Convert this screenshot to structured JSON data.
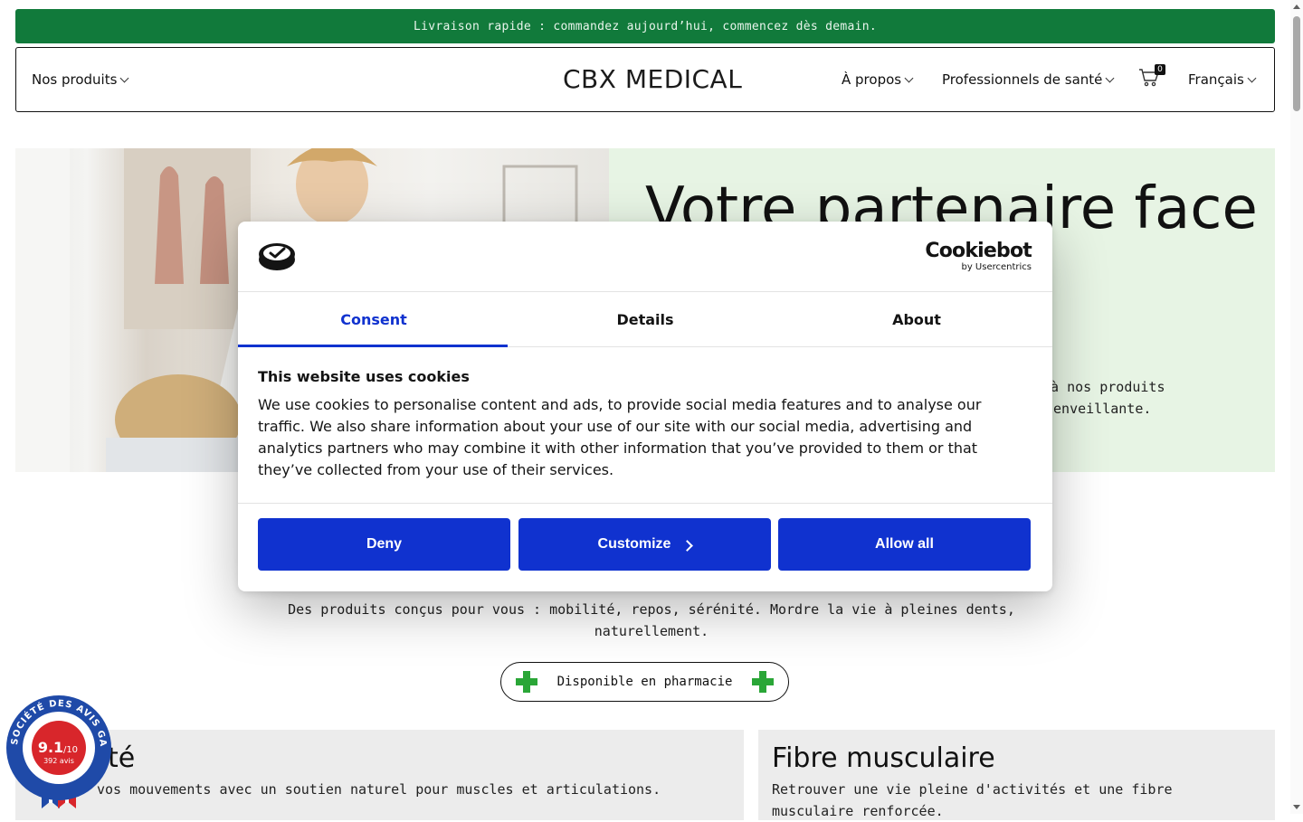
{
  "announcement": {
    "text": "Livraison rapide : commandez aujourd’hui, commencez dès demain."
  },
  "header": {
    "nav_products": "Nos produits",
    "logo": "CBX MEDICAL",
    "nav_about": "À propos",
    "nav_professionals": "Professionnels de santé",
    "cart_count": "0",
    "language": "Français"
  },
  "hero": {
    "title": "Votre partenaire face",
    "text_line1": "e à nos produits",
    "text_line2": "ienveillante."
  },
  "section": {
    "tagline": "Des produits conçus pour vous : mobilité, repos, sérénité. Mordre la vie à pleines dents, naturellement.",
    "pharmacy_button": "Disponible en pharmacie"
  },
  "cards": [
    {
      "title": "té",
      "text": "vos mouvements avec un soutien naturel pour muscles et articulations."
    },
    {
      "title": "Fibre musculaire",
      "text": "Retrouver une vie pleine d'activités et une fibre musculaire renforcée."
    }
  ],
  "review_badge": {
    "ring_text": "SOCIÉTÉ DES AVIS GARANTIS",
    "score": "9.1",
    "scale": "/10",
    "count": "392 avis"
  },
  "cookie_dialog": {
    "brand": "Cookiebot",
    "brand_sub": "by Usercentrics",
    "tabs": [
      "Consent",
      "Details",
      "About"
    ],
    "heading": "This website uses cookies",
    "body": "We use cookies to personalise content and ads, to provide social media features and to analyse our traffic. We also share information about your use of our site with our social media, advertising and analytics partners who may combine it with other information that you’ve provided to them or that they’ve collected from your use of their services.",
    "buttons": {
      "deny": "Deny",
      "customize": "Customize",
      "allow_all": "Allow all"
    }
  },
  "colors": {
    "announcement_bg": "#117a3b",
    "hero_panel_bg": "#e7f4e4",
    "cookie_primary": "#1032cf",
    "pharmacy_cross": "#2aa637",
    "badge_blue": "#1f4aa8",
    "badge_red": "#d8262b"
  }
}
